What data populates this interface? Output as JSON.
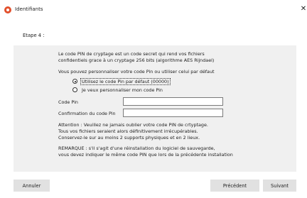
{
  "window": {
    "title": "Identifiants",
    "close_glyph": "✕"
  },
  "step_label": "Etape 4 :",
  "intro": {
    "line1": "Le code PIN de cryptage est un code secret qui rend vos fichiers",
    "line2": "confidentiels grace à un cryptage 256 bits (algorithme AES Rijndael)",
    "line3": "Vous pouvez personnaliser votre code Pin ou utiliser celui par défaut"
  },
  "options": [
    {
      "label": "Utilisez le code Pin par défaut (00000)",
      "selected": true
    },
    {
      "label": "Je veux personnaliser mon code Pin",
      "selected": false
    }
  ],
  "fields": {
    "pin_label": "Code Pin",
    "pin_value": "",
    "confirm_label": "Confirmation du code Pin",
    "confirm_value": ""
  },
  "warning": {
    "line1": "Attention : Veuillez ne jamais oublier votre code PIN de crtyptage.",
    "line2": "Tous vos fichiers seraient alors définitivement irrécupérables.",
    "line3": "Conservez-le sur au moins 2 supports physiques et en 2 lieux."
  },
  "remark": {
    "line1": "REMARQUE : s'il s'agit d'une réinstallation du logiciel de sauvegarde,",
    "line2": "vous devez indiquer le même code PIN que lors de la précédente installation"
  },
  "buttons": {
    "cancel": "Annuler",
    "previous": "Précédent",
    "next": "Suivant"
  },
  "colors": {
    "accent": "#e2502c",
    "panel_bg": "#f0f0f0",
    "button_bg": "#e1e1e1"
  }
}
